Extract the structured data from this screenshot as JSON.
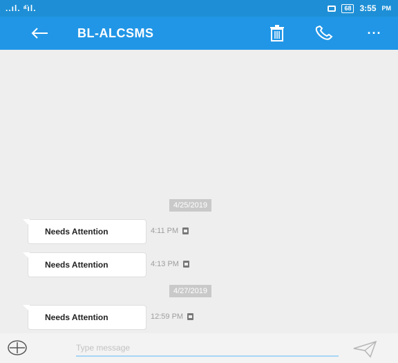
{
  "status_bar": {
    "signal_text": "..ıl. ᵃ̈ıl.",
    "battery": "68",
    "time": "3:55",
    "ampm": "PM"
  },
  "app_bar": {
    "title": "BL-ALCSMS",
    "back_icon": "arrow-left-icon",
    "delete_icon": "trash-icon",
    "call_icon": "phone-icon",
    "more_label": "···",
    "color": "#2196e6"
  },
  "thread": {
    "groups": [
      {
        "date": "4/25/2019",
        "messages": [
          {
            "text": "Needs Attention",
            "time": "4:11 PM"
          },
          {
            "text": "Needs Attention",
            "time": "4:13 PM"
          }
        ]
      },
      {
        "date": "4/27/2019",
        "messages": [
          {
            "text": "Needs Attention",
            "time": "12:59 PM"
          }
        ]
      }
    ]
  },
  "composer": {
    "add_icon": "plus-circle-icon",
    "placeholder": "Type message",
    "value": "",
    "send_icon": "send-icon"
  }
}
